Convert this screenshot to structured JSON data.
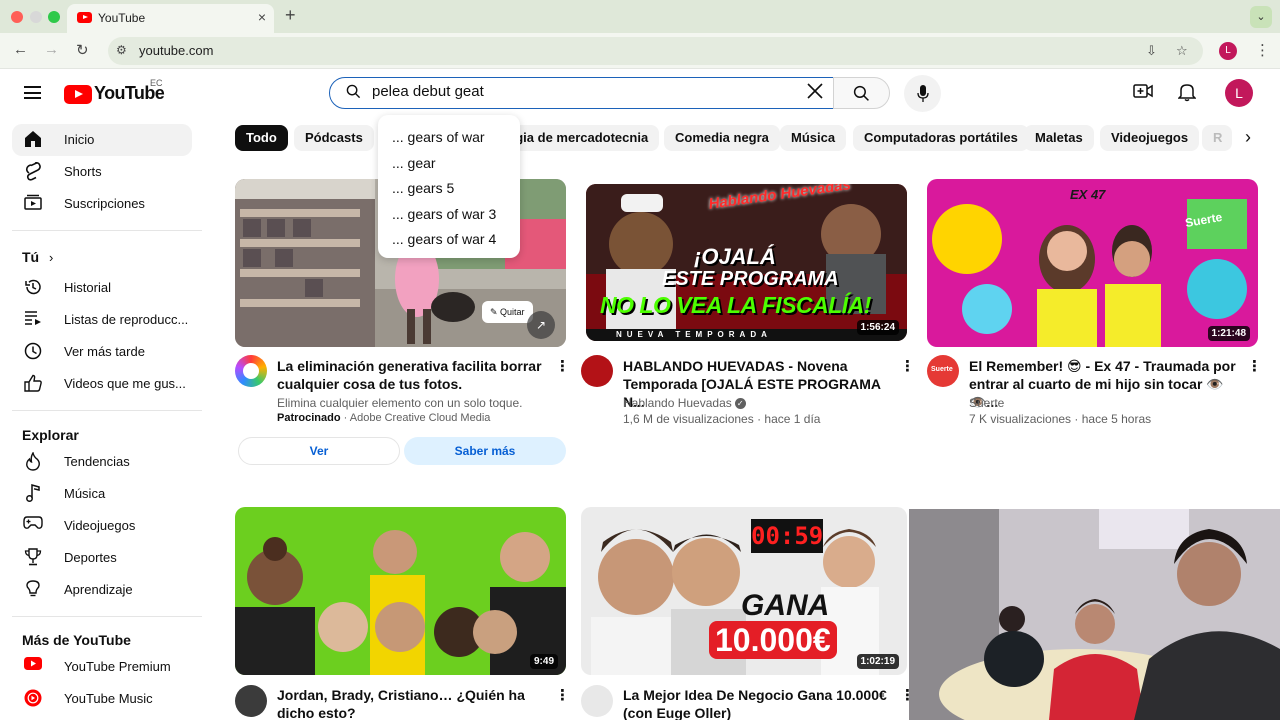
{
  "browser": {
    "tab_title": "YouTube",
    "tab_close": "×",
    "new_tab": "+",
    "url": "youtube.com",
    "profile_initial": "L"
  },
  "masthead": {
    "logo_text": "YouTube",
    "country_code": "EC",
    "search_value": "pelea debut geat",
    "avatar_initial": "L"
  },
  "suggestions": [
    "... gears of war",
    "... gear",
    "... gears 5",
    "... gears of war 3",
    "... gears of war 4"
  ],
  "chips": [
    "Todo",
    "Pódcasts",
    "egia de mercadotecnia",
    "Comedia negra",
    "Música",
    "Computadoras portátiles",
    "Maletas",
    "Videojuegos",
    "R"
  ],
  "sidebar": {
    "main": [
      {
        "label": "Inicio",
        "icon": "home-icon"
      },
      {
        "label": "Shorts",
        "icon": "shorts-icon"
      },
      {
        "label": "Suscripciones",
        "icon": "subscriptions-icon"
      }
    ],
    "you_heading": "Tú",
    "you": [
      {
        "label": "Historial",
        "icon": "history-icon"
      },
      {
        "label": "Listas de reproducc...",
        "icon": "playlists-icon"
      },
      {
        "label": "Ver más tarde",
        "icon": "watch-later-icon"
      },
      {
        "label": "Videos que me gus...",
        "icon": "liked-videos-icon"
      }
    ],
    "explore_heading": "Explorar",
    "explore": [
      {
        "label": "Tendencias",
        "icon": "trending-icon"
      },
      {
        "label": "Música",
        "icon": "music-icon"
      },
      {
        "label": "Videojuegos",
        "icon": "gaming-icon"
      },
      {
        "label": "Deportes",
        "icon": "sports-icon"
      },
      {
        "label": "Aprendizaje",
        "icon": "learning-icon"
      }
    ],
    "more_heading": "Más de YouTube",
    "more": [
      {
        "label": "YouTube Premium",
        "icon": "youtube-premium-icon"
      },
      {
        "label": "YouTube Music",
        "icon": "youtube-music-icon"
      }
    ]
  },
  "ad": {
    "title": "La eliminación generativa facilita borrar cualquier cosa de tus fotos.",
    "description": "Elimina cualquier elemento con un solo toque.",
    "sponsored": "Patrocinado",
    "advertiser": "· Adobe Creative Cloud Media",
    "btn_view": "Ver",
    "btn_more": "Saber más",
    "remove_label": "Quitar"
  },
  "videos": [
    {
      "title": "HABLANDO HUEVADAS - Novena Temporada [OJALÁ ESTE PROGRAMA N...",
      "channel": "Hablando Huevadas",
      "views": "1,6 M de visualizaciones",
      "age": "hace 1 día",
      "duration": "1:56:24",
      "thumb_text_1": "¡OJALÁ",
      "thumb_text_2": "ESTE PROGRAMA",
      "thumb_text_3": "NO LO VEA LA FISCALÍA!",
      "thumb_text_4": "Hablando Huevadas",
      "thumb_text_5": "NUEVA TEMPORADA"
    },
    {
      "title": "El Remember! 😎 - Ex 47 - Traumada por entrar al cuarto de mi hijo sin tocar 👁️👁️...",
      "channel": "Suerte",
      "views": "7 K visualizaciones",
      "age": "hace 5 horas",
      "duration": "1:21:48",
      "thumb_text_1": "EX 47",
      "thumb_text_2": "Suerte"
    },
    {
      "title": "Jordan, Brady, Cristiano… ¿Quién ha dicho esto?",
      "duration": "9:49"
    },
    {
      "title": "La Mejor Idea De Negocio Gana 10.000€ (con Euge Oller)",
      "duration": "1:02:19",
      "thumb_timer": "00:59",
      "thumb_text_1": "GANA",
      "thumb_text_2": "10.000€"
    }
  ],
  "colors": {
    "accent_blue": "#065fd4",
    "yt_red": "#ff0000",
    "chip_active": "#0f0f0f"
  }
}
